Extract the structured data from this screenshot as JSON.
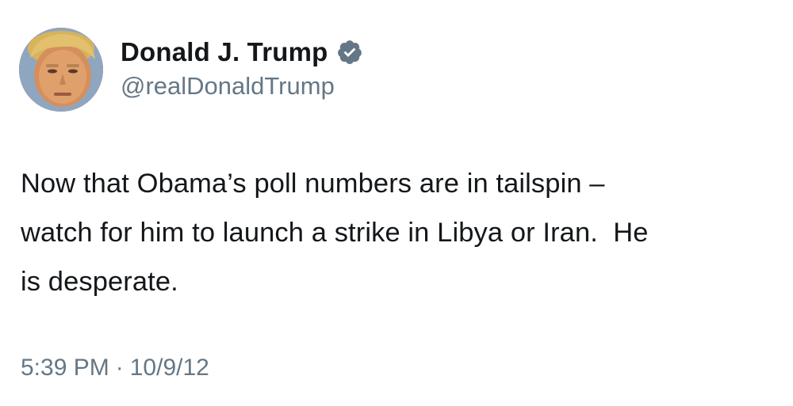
{
  "tweet": {
    "author": {
      "display_name": "Donald J. Trump",
      "handle": "@realDonaldTrump",
      "verified": true,
      "verified_icon": "verified-badge-icon",
      "avatar_icon": "profile-photo"
    },
    "lines": [
      "Now that Obama’s poll numbers are in tailspin –",
      "watch for him to launch a strike in Libya or Iran.  He",
      "is desperate."
    ],
    "time": "5:39 PM",
    "separator": "·",
    "date": "10/9/12"
  },
  "colors": {
    "text_primary": "#14171a",
    "text_secondary": "#657786",
    "verified_badge": "#657786",
    "background": "#ffffff"
  }
}
